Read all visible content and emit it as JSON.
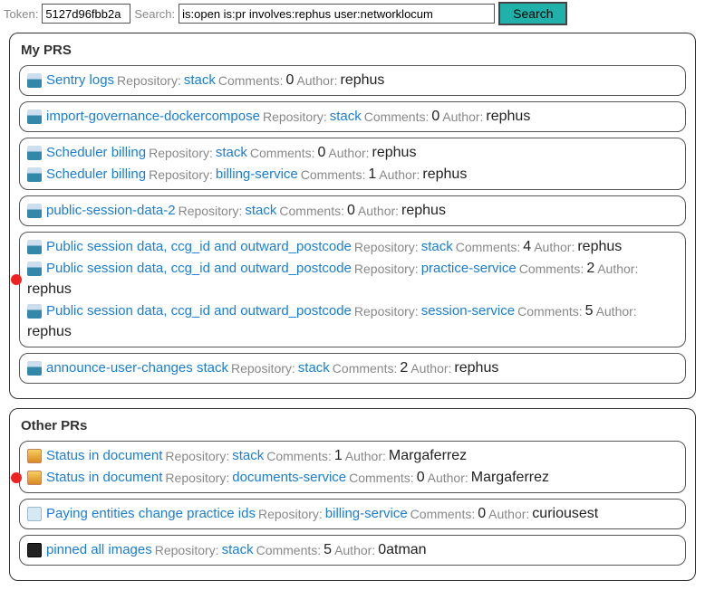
{
  "topbar": {
    "token_label": "Token:",
    "token_value": "5127d96fbb2a",
    "search_label": "Search:",
    "search_value": "is:open is:pr involves:rephus user:networklocum",
    "search_button": "Search"
  },
  "labels": {
    "repository": "Repository:",
    "comments": "Comments:",
    "author": "Author:"
  },
  "sections": [
    {
      "title": "My PRS",
      "groups": [
        [
          {
            "avatar": "av-blue",
            "title": "Sentry logs",
            "repo": "stack",
            "comments": 0,
            "author": "rephus",
            "dot": false
          }
        ],
        [
          {
            "avatar": "av-blue",
            "title": "import-governance-dockercompose",
            "repo": "stack",
            "comments": 0,
            "author": "rephus",
            "dot": false
          }
        ],
        [
          {
            "avatar": "av-blue",
            "title": "Scheduler billing",
            "repo": "stack",
            "comments": 0,
            "author": "rephus",
            "dot": false
          },
          {
            "avatar": "av-blue",
            "title": "Scheduler billing",
            "repo": "billing-service",
            "comments": 1,
            "author": "rephus",
            "dot": false
          }
        ],
        [
          {
            "avatar": "av-blue",
            "title": "public-session-data-2",
            "repo": "stack",
            "comments": 0,
            "author": "rephus",
            "dot": false
          }
        ],
        [
          {
            "avatar": "av-blue",
            "title": "Public session data, ccg_id and outward_postcode",
            "repo": "stack",
            "comments": 4,
            "author": "rephus",
            "dot": false
          },
          {
            "avatar": "av-blue",
            "title": "Public session data, ccg_id and outward_postcode",
            "repo": "practice-service",
            "comments": 2,
            "author": "rephus",
            "dot": true
          },
          {
            "avatar": "av-blue",
            "title": "Public session data, ccg_id and outward_postcode",
            "repo": "session-service",
            "comments": 5,
            "author": "rephus",
            "dot": false
          }
        ],
        [
          {
            "avatar": "av-blue",
            "title": "announce-user-changes stack",
            "repo": "stack",
            "comments": 2,
            "author": "rephus",
            "dot": false
          }
        ]
      ]
    },
    {
      "title": "Other PRs",
      "groups": [
        [
          {
            "avatar": "av-orange",
            "title": "Status in document",
            "repo": "stack",
            "comments": 1,
            "author": "Margaferrez",
            "dot": false
          },
          {
            "avatar": "av-orange",
            "title": "Status in document",
            "repo": "documents-service",
            "comments": 0,
            "author": "Margaferrez",
            "dot": true
          }
        ],
        [
          {
            "avatar": "av-whale",
            "title": "Paying entities change practice ids",
            "repo": "billing-service",
            "comments": 0,
            "author": "curiousest",
            "dot": false
          }
        ],
        [
          {
            "avatar": "av-dark",
            "title": "pinned all images",
            "repo": "stack",
            "comments": 5,
            "author": "0atman",
            "dot": false
          }
        ]
      ]
    }
  ]
}
